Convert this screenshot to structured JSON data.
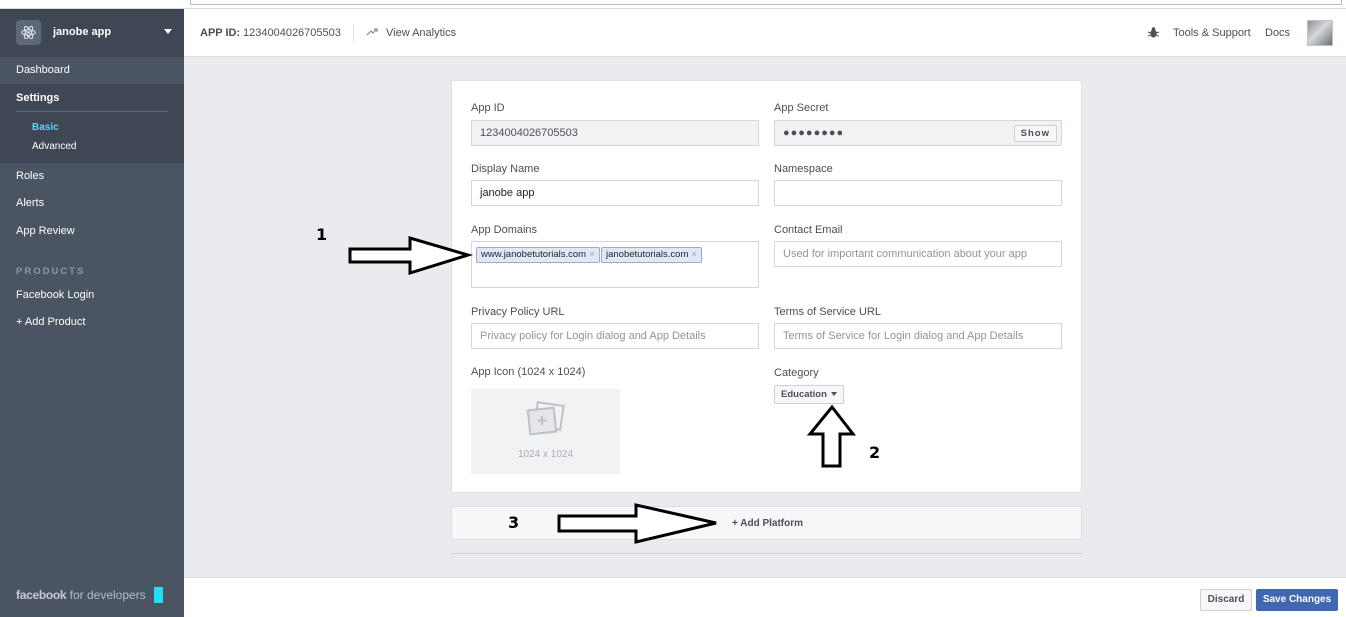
{
  "sidebar": {
    "app_name": "janobe app",
    "items": [
      {
        "label": "Dashboard"
      },
      {
        "label": "Settings"
      },
      {
        "label": "Roles"
      },
      {
        "label": "Alerts"
      },
      {
        "label": "App Review"
      }
    ],
    "settings_sub": [
      {
        "label": "Basic",
        "active": true
      },
      {
        "label": "Advanced",
        "active": false
      }
    ],
    "products_label": "PRODUCTS",
    "products": [
      {
        "label": "Facebook Login"
      },
      {
        "label": "+ Add Product"
      }
    ],
    "footer_brand": "facebook",
    "footer_suffix": "for developers"
  },
  "topbar": {
    "app_id_label": "APP ID:",
    "app_id_value": "1234004026705503",
    "analytics_label": "View Analytics",
    "tools_label": "Tools & Support",
    "docs_label": "Docs"
  },
  "form": {
    "app_id": {
      "label": "App ID",
      "value": "1234004026705503"
    },
    "app_secret": {
      "label": "App Secret",
      "value": "●●●●●●●●",
      "show_label": "Show"
    },
    "display_name": {
      "label": "Display Name",
      "value": "janobe app"
    },
    "namespace": {
      "label": "Namespace",
      "value": ""
    },
    "app_domains": {
      "label": "App Domains",
      "tokens": [
        "www.janobetutorials.com",
        "janobetutorials.com"
      ],
      "remove_glyph": "×"
    },
    "contact_email": {
      "label": "Contact Email",
      "placeholder": "Used for important communication about your app"
    },
    "privacy_url": {
      "label": "Privacy Policy URL",
      "placeholder": "Privacy policy for Login dialog and App Details"
    },
    "tos_url": {
      "label": "Terms of Service URL",
      "placeholder": "Terms of Service for Login dialog and App Details"
    },
    "app_icon": {
      "label": "App Icon (1024 x 1024)",
      "size_text": "1024 x 1024"
    },
    "category": {
      "label": "Category",
      "value": "Education"
    }
  },
  "platform": {
    "label": "+ Add Platform"
  },
  "footer": {
    "discard_label": "Discard",
    "save_label": "Save Changes"
  },
  "annotations": {
    "one": "1",
    "two": "2",
    "three": "3"
  },
  "colors": {
    "sidebar": "#4b5463",
    "sidebar_active": "#3f4654",
    "accent": "#4267b2",
    "active_sub": "#5ad7ff"
  }
}
